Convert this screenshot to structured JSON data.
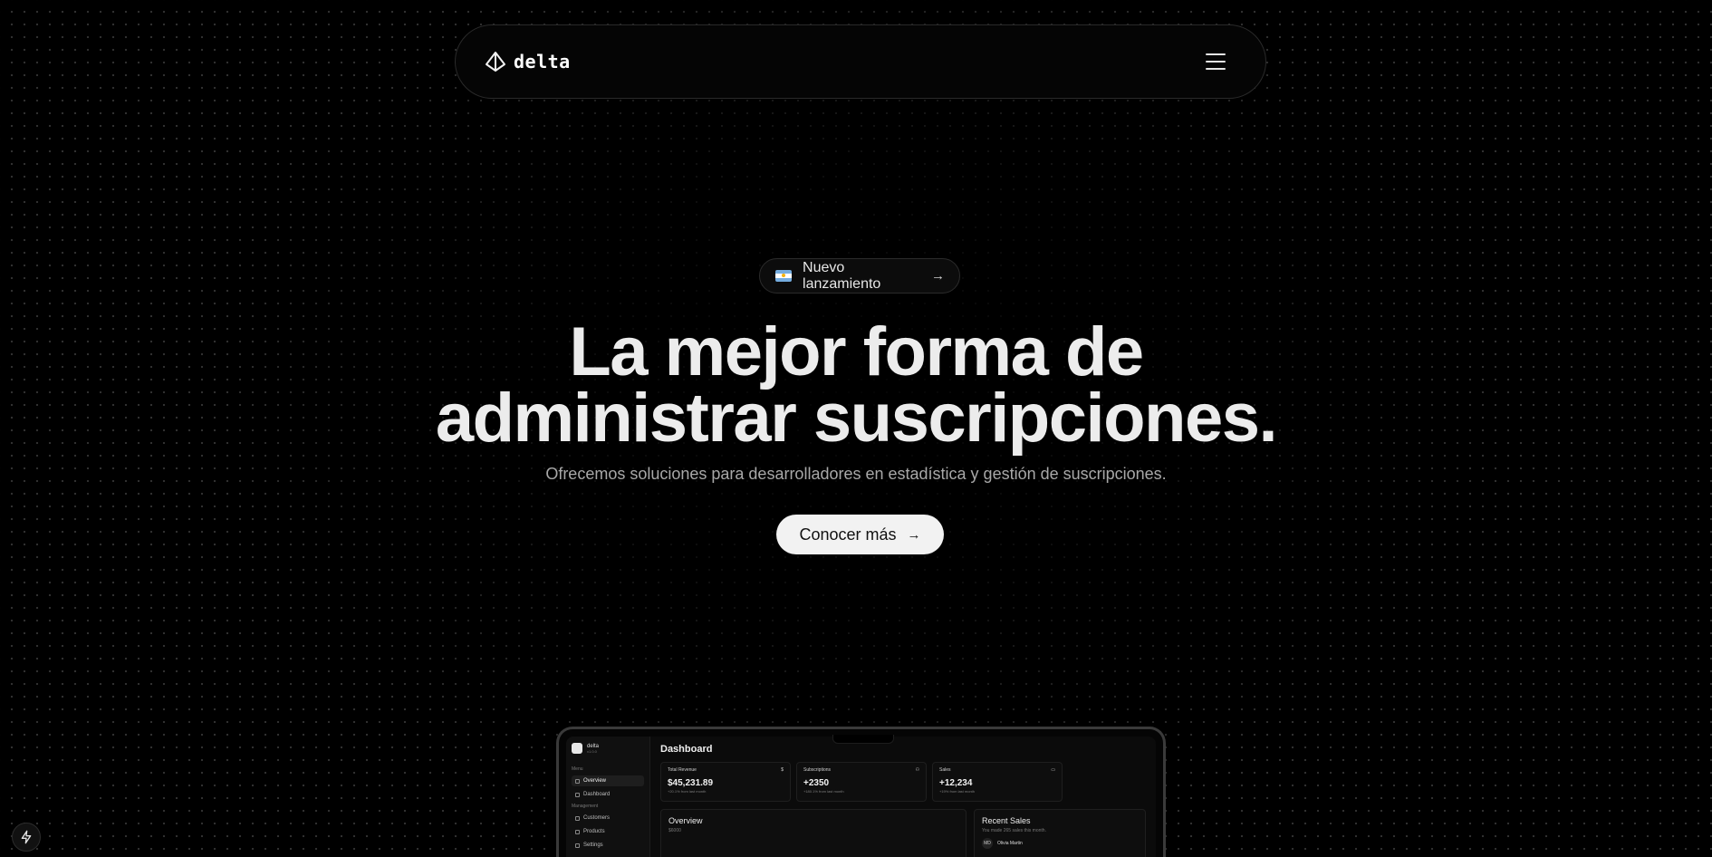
{
  "nav": {
    "brand": "delta",
    "menu_icon": "hamburger-menu-icon"
  },
  "hero": {
    "badge": {
      "flag_icon": "argentina-flag-icon",
      "label": "Nuevo lanzamiento",
      "arrow_icon": "arrow-right-icon"
    },
    "headline_line1": "La mejor forma de",
    "headline_line2": "administrar suscripciones.",
    "subtitle": "Ofrecemos soluciones para desarrolladores en estadística y gestión de suscripciones.",
    "cta_label": "Conocer más",
    "cta_icon": "arrow-right-icon"
  },
  "preview": {
    "sidebar": {
      "brand": "delta",
      "brand_sub": "v1.0.0",
      "group1": "Menu",
      "items1": [
        "Overview",
        "Dashboard"
      ],
      "group2": "Management",
      "items2": [
        "Customers",
        "Products",
        "Settings"
      ]
    },
    "title": "Dashboard",
    "cards": [
      {
        "label": "Total Revenue",
        "icon": "$",
        "value": "$45,231.89",
        "note": "+20.1% from last month"
      },
      {
        "label": "Subscriptions",
        "icon": "users-icon",
        "value": "+2350",
        "note": "+180.1% from last month"
      },
      {
        "label": "Sales",
        "icon": "card-icon",
        "value": "+12,234",
        "note": "+19% from last month"
      }
    ],
    "overview": {
      "title": "Overview",
      "axis": "$6000"
    },
    "recent": {
      "title": "Recent Sales",
      "subtitle": "You made 265 sales this month.",
      "first_initials": "MD",
      "first_name": "Olivia Martin"
    }
  },
  "floating": {
    "icon": "bolt-icon"
  },
  "colors": {
    "background": "#000000",
    "cta_bg": "#f2f2f2",
    "text": "#ececec"
  }
}
